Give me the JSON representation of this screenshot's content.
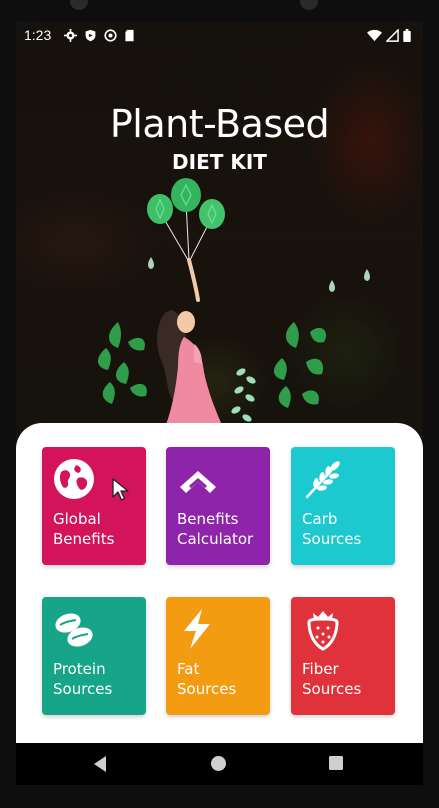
{
  "status_bar": {
    "time": "1:23",
    "left_icons": [
      "settings-icon",
      "shield-icon",
      "sync-icon",
      "sd-card-icon"
    ],
    "right_icons": [
      "wifi-icon",
      "signal-icon",
      "battery-icon"
    ]
  },
  "header": {
    "title": "Plant-Based",
    "subtitle": "DIET KIT"
  },
  "tiles": [
    {
      "icon": "globe-icon",
      "line1": "Global",
      "line2": "Benefits",
      "color": "#d4145a"
    },
    {
      "icon": "chevron-up-icon",
      "line1": "Benefits",
      "line2": "Calculator",
      "color": "#8e24aa"
    },
    {
      "icon": "wheat-icon",
      "line1": "Carb",
      "line2": "Sources",
      "color": "#1cc9cf"
    },
    {
      "icon": "seeds-icon",
      "line1": "Protein",
      "line2": "Sources",
      "color": "#17a589"
    },
    {
      "icon": "lightning-icon",
      "line1": "Fat",
      "line2": "Sources",
      "color": "#f39c12"
    },
    {
      "icon": "strawberry-icon",
      "line1": "Fiber",
      "line2": "Sources",
      "color": "#e0323a"
    }
  ],
  "nav_bar": {
    "icons": [
      "back-icon",
      "home-icon",
      "recents-icon"
    ]
  }
}
